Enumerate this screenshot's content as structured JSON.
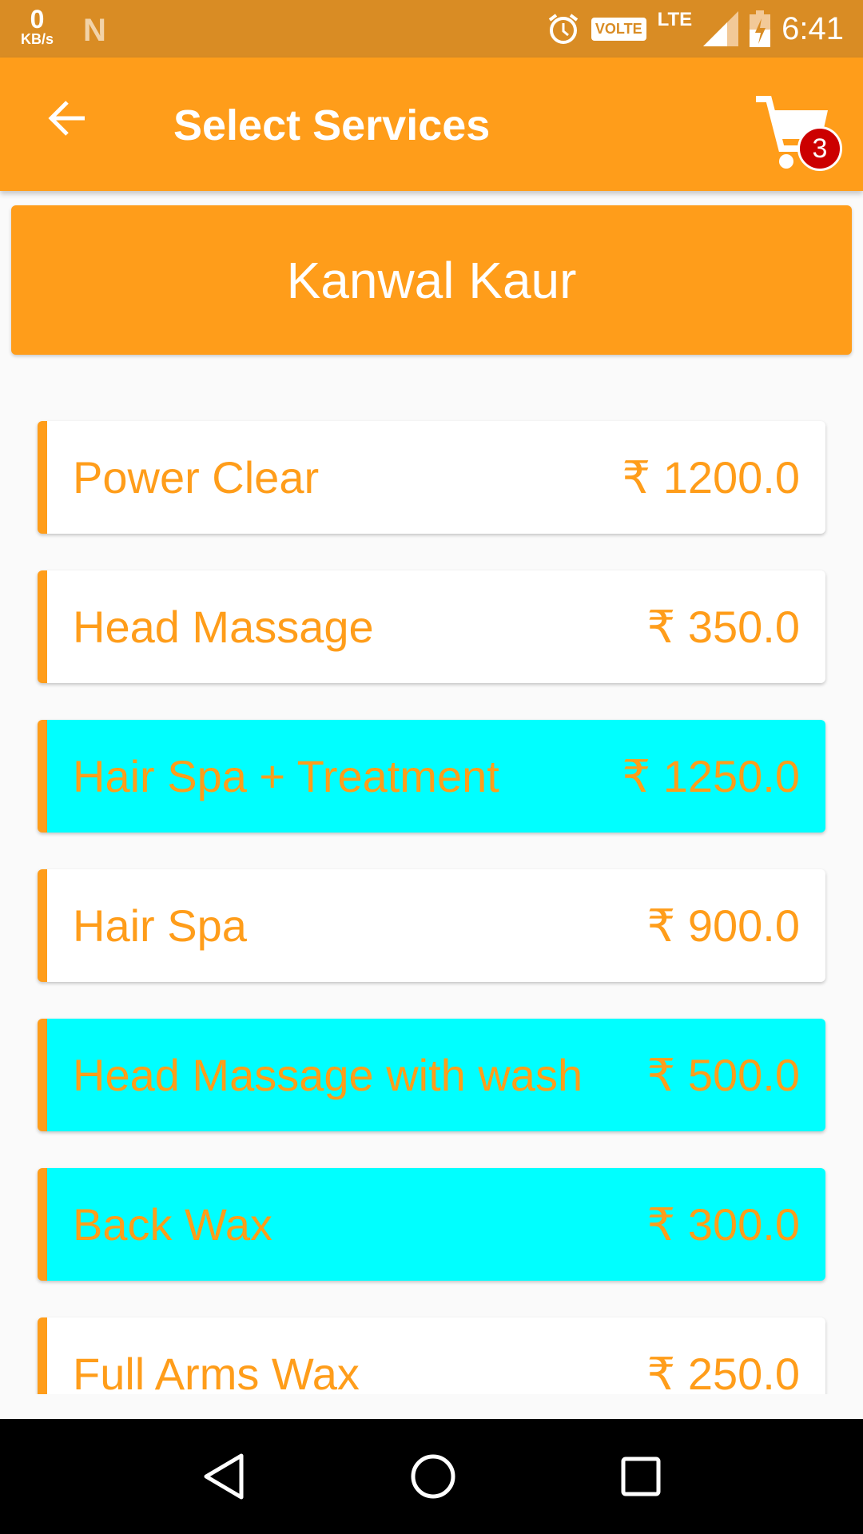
{
  "status_bar": {
    "speed_value": "0",
    "speed_unit": "KB/s",
    "volte": "VOLTE",
    "network": "LTE",
    "time": "6:41"
  },
  "toolbar": {
    "title": "Select Services",
    "cart_count": "3"
  },
  "stylist": {
    "name": "Kanwal Kaur"
  },
  "services": [
    {
      "name": "Power Clear",
      "price": "₹ 1200.0",
      "selected": false
    },
    {
      "name": "Head Massage",
      "price": "₹ 350.0",
      "selected": false
    },
    {
      "name": "Hair Spa + Treatment",
      "price": "₹ 1250.0",
      "selected": true
    },
    {
      "name": "Hair Spa",
      "price": "₹ 900.0",
      "selected": false
    },
    {
      "name": "Head Massage with wash",
      "price": "₹ 500.0",
      "selected": true
    },
    {
      "name": "Back Wax",
      "price": "₹ 300.0",
      "selected": true
    },
    {
      "name": "Full Arms Wax",
      "price": "₹ 250.0",
      "selected": false
    }
  ],
  "colors": {
    "accent": "#ff9d1a",
    "selected_bg": "#00ffff",
    "badge": "#cc0000",
    "status_bar": "#d98c24"
  }
}
